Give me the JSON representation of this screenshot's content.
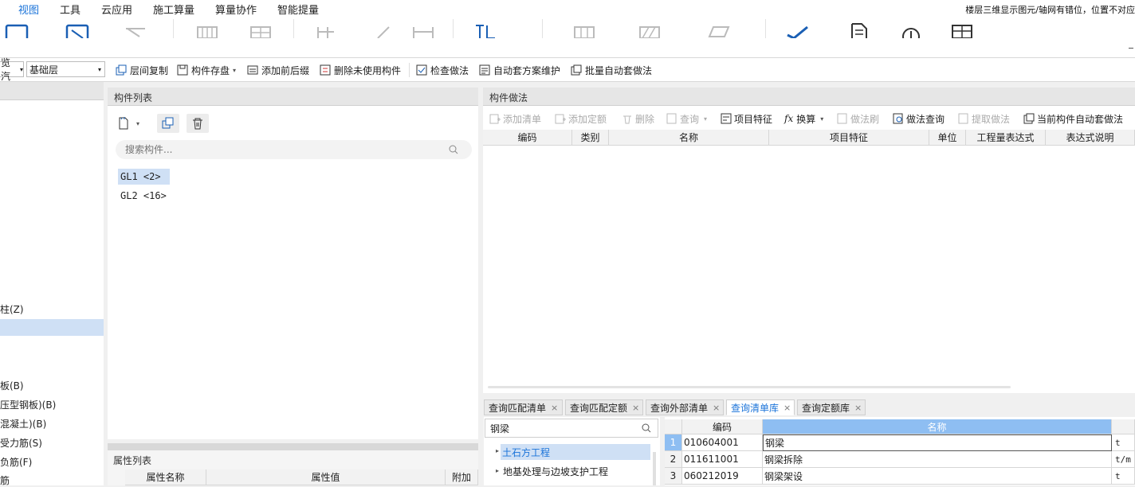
{
  "menu": {
    "items": [
      "视图",
      "工具",
      "云应用",
      "施工算量",
      "算量协作",
      "智能提量"
    ],
    "active_index": 0,
    "notice": "楼层三维显示图元/轴网有错位，位置不对应"
  },
  "toolbar": {
    "left_select_value": "览汽",
    "floor_select_value": "基础层",
    "buttons": [
      "层间复制",
      "构件存盘",
      "添加前后缀",
      "删除未使用构件",
      "检查做法",
      "自动套方案维护",
      "批量自动套做法"
    ]
  },
  "left_tree": {
    "items": [
      "柱(Z)",
      "",
      "板(B)",
      "压型钢板)(B)",
      "混凝土)(B)",
      "受力筋(S)",
      "负筋(F)",
      "筋"
    ],
    "selected_index": 1
  },
  "component_list": {
    "title": "构件列表",
    "search_placeholder": "搜索构件...",
    "items": [
      "GL1 <2>",
      "GL2 <16>"
    ],
    "selected_index": 0
  },
  "property_list": {
    "title": "属性列表",
    "columns": [
      "属性名称",
      "属性值",
      "附加"
    ]
  },
  "method_panel": {
    "title": "构件做法",
    "buttons": [
      {
        "label": "添加清单",
        "enabled": false
      },
      {
        "label": "添加定额",
        "enabled": false
      },
      {
        "label": "删除",
        "enabled": false
      },
      {
        "label": "查询",
        "enabled": false
      },
      {
        "label": "项目特征",
        "enabled": true
      },
      {
        "label": "换算",
        "enabled": true
      },
      {
        "label": "做法刷",
        "enabled": false
      },
      {
        "label": "做法查询",
        "enabled": true
      },
      {
        "label": "提取做法",
        "enabled": false
      },
      {
        "label": "当前构件自动套做法",
        "enabled": true
      }
    ],
    "columns": [
      "编码",
      "类别",
      "名称",
      "项目特征",
      "单位",
      "工程量表达式",
      "表达式说明"
    ]
  },
  "query_tabs": {
    "tabs": [
      "查询匹配清单",
      "查询匹配定额",
      "查询外部清单",
      "查询清单库",
      "查询定额库"
    ],
    "active_index": 3
  },
  "library": {
    "search_value": "钢梁",
    "tree": [
      "土石方工程",
      "地基处理与边坡支护工程"
    ],
    "tree_selected_index": 0,
    "columns": [
      "编码",
      "名称"
    ],
    "rows": [
      {
        "no": "1",
        "code": "010604001",
        "name": "钢梁",
        "unit": "t"
      },
      {
        "no": "2",
        "code": "011611001",
        "name": "钢梁拆除",
        "unit": "t/m"
      },
      {
        "no": "3",
        "code": "060212019",
        "name": "钢梁架设",
        "unit": "t"
      }
    ]
  },
  "colors": {
    "accent": "#1a73d9",
    "selection": "#cfe0f5",
    "header_blue": "#8ebef2"
  }
}
